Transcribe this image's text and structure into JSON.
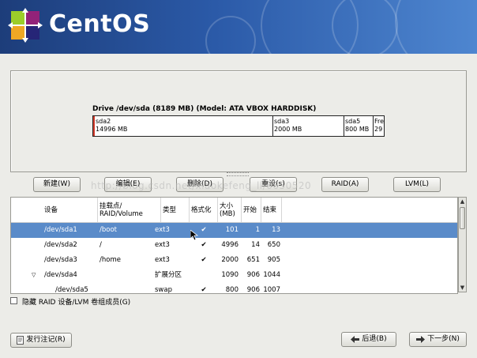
{
  "brand": {
    "name": "CentOS"
  },
  "drive": {
    "title": "Drive /dev/sda (8189 MB) (Model: ATA VBOX HARDDISK)",
    "segments": [
      {
        "name": "sda2",
        "size": "14996 MB"
      },
      {
        "name": "sda3",
        "size": "2000 MB"
      },
      {
        "name": "sda5",
        "size": "800 MB"
      },
      {
        "name": "Fre",
        "size": "29"
      }
    ]
  },
  "buttons": {
    "new": "新建(W)",
    "edit": "编辑(E)",
    "delete": "删除(D)",
    "reset": "重设(s)",
    "raid": "RAID(A)",
    "lvm": "LVM(L)",
    "release_notes": "发行注记(R)",
    "back": "后退(B)",
    "next": "下一步(N)"
  },
  "table": {
    "headers": {
      "device": "设备",
      "mount": "挂载点/\nRAID/Volume",
      "type": "类型",
      "format": "格式化",
      "size": "大小\n(MB)",
      "start": "开始",
      "end": "结束"
    },
    "rows": [
      {
        "device": "/dev/sda1",
        "mount": "/boot",
        "type": "ext3",
        "format": "✔",
        "size": "101",
        "start": "1",
        "end": "13"
      },
      {
        "device": "/dev/sda2",
        "mount": "/",
        "type": "ext3",
        "format": "✔",
        "size": "4996",
        "start": "14",
        "end": "650"
      },
      {
        "device": "/dev/sda3",
        "mount": "/home",
        "type": "ext3",
        "format": "✔",
        "size": "2000",
        "start": "651",
        "end": "905"
      },
      {
        "device": "/dev/sda4",
        "mount": "",
        "type": "扩展分区",
        "format": "",
        "size": "1090",
        "start": "906",
        "end": "1044"
      },
      {
        "device": "/dev/sda5",
        "mount": "",
        "type": "swap",
        "format": "✔",
        "size": "800",
        "start": "906",
        "end": "1007"
      }
    ]
  },
  "hide_raid_label": "隐藏 RAID 设备/LVM 卷组成员(G)",
  "watermark": "http://blog.csdn.net/xiaokefeng_ll/6650520",
  "colors": {
    "selection": "#5a8bc9",
    "banner": "#2b5aa8"
  },
  "icons": {
    "release_notes": "document-icon",
    "back": "back-arrow-icon",
    "next": "forward-arrow-icon",
    "expander": "expander-triangle-icon"
  }
}
